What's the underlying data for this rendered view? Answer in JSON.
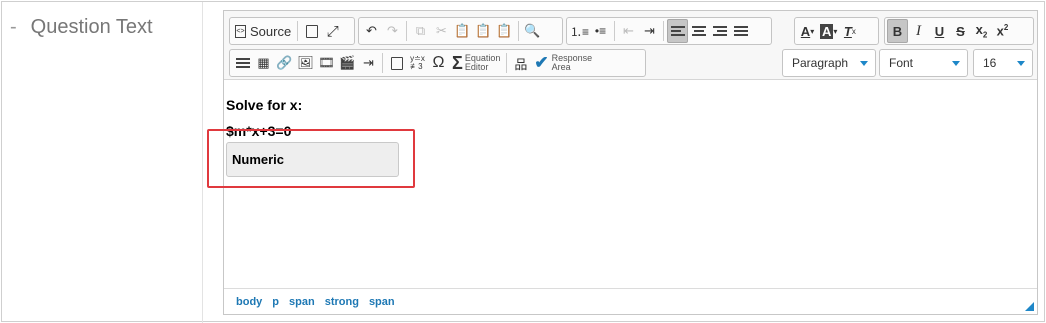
{
  "field": {
    "label": "Question Text",
    "dash": "-"
  },
  "toolbar": {
    "source_label": "Source",
    "equation_label_1": "Equation",
    "equation_label_2": "Editor",
    "response_label_1": "Response",
    "response_label_2": "Area",
    "format_select": "Paragraph",
    "font_select": "Font",
    "size_select": "16",
    "accent_color": "#1e87c8"
  },
  "content": {
    "line1": "Solve for x:",
    "line2": "$m*x+3=0",
    "response_box": "Numeric"
  },
  "statusbar": {
    "path": [
      "body",
      "p",
      "span",
      "strong",
      "span"
    ]
  },
  "highlight_color": "#e0393e"
}
